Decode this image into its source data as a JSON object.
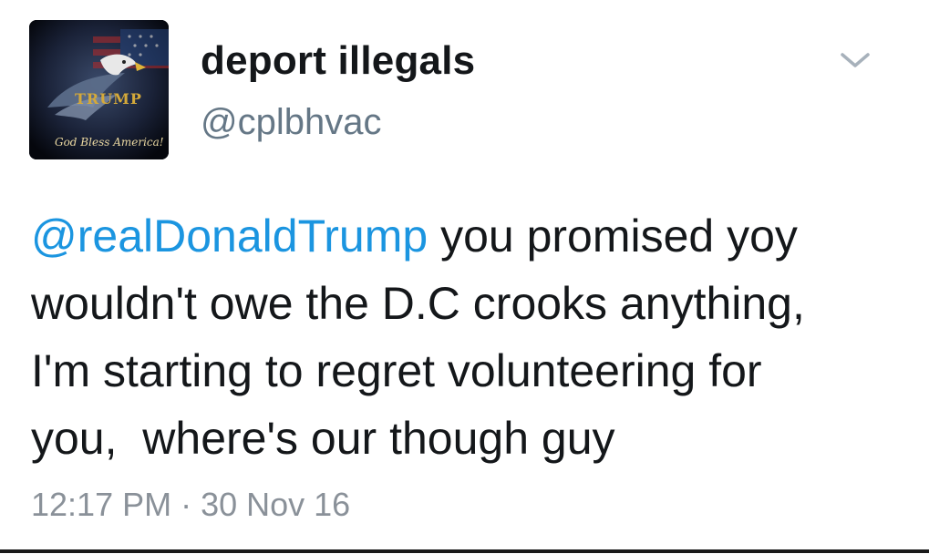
{
  "user": {
    "display_name": "deport illegals",
    "handle": "@cplbhvac",
    "avatar_icon": "eagle-flag-avatar",
    "avatar_text_top": "TRUMP",
    "avatar_text_bottom": "God Bless America!"
  },
  "menu": {
    "caret_icon": "chevron-down-icon"
  },
  "tweet": {
    "mention": "@realDonaldTrump",
    "body": " you promised yoy\nwouldn't owe the D.C crooks anything,\nI'm starting to regret volunteering for\nyou,  where's our though guy",
    "timestamp": "12:17 PM · 30 Nov 16"
  },
  "colors": {
    "link": "#1b95e0",
    "text": "#14171a",
    "secondary": "#657786",
    "timestamp": "#8a9199"
  }
}
